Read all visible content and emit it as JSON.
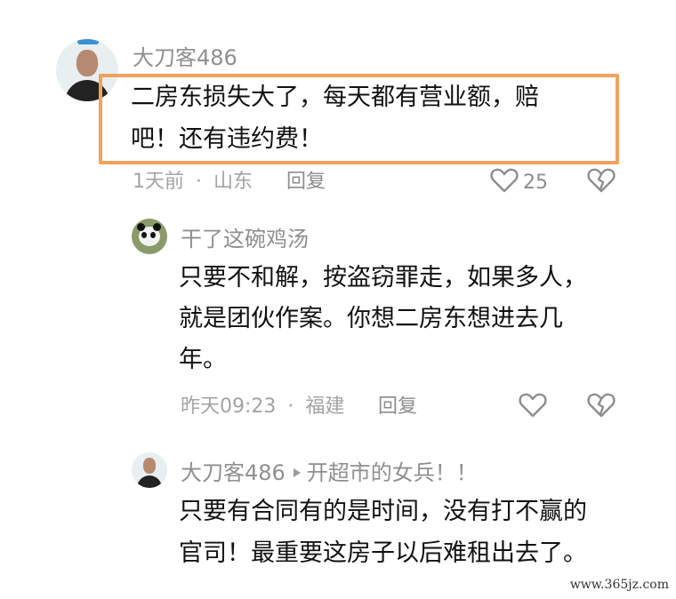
{
  "comments": [
    {
      "user": "大刀客486",
      "text_line1": "二房东损失大了，每天都有营业额，赔",
      "text_line2": "吧！还有违约费！",
      "time": "1天前",
      "location": "山东",
      "reply_label": "回复",
      "like_count": "25"
    },
    {
      "user": "干了这碗鸡汤",
      "text_line1": "只要不和解，按盗窃罪走，如果多人，",
      "text_line2": "就是团伙作案。你想二房东想进去几",
      "text_line3": "年。",
      "time": "昨天09:23",
      "location": "福建",
      "reply_label": "回复"
    },
    {
      "user": "大刀客486",
      "reply_to": "开超市的女兵！！",
      "text_line1": "只要有合同有的是时间，没有打不赢的",
      "text_line2": "官司！最重要这房子以后难租出去了。"
    }
  ],
  "separator": "·",
  "watermark": "www.365jz.com",
  "icons": {
    "like": "heart-outline-icon",
    "dislike": "broken-heart-icon",
    "reply_arrow": "triangle-right-icon"
  },
  "colors": {
    "highlight": "#f0a25e",
    "meta": "#a3a3a3"
  }
}
